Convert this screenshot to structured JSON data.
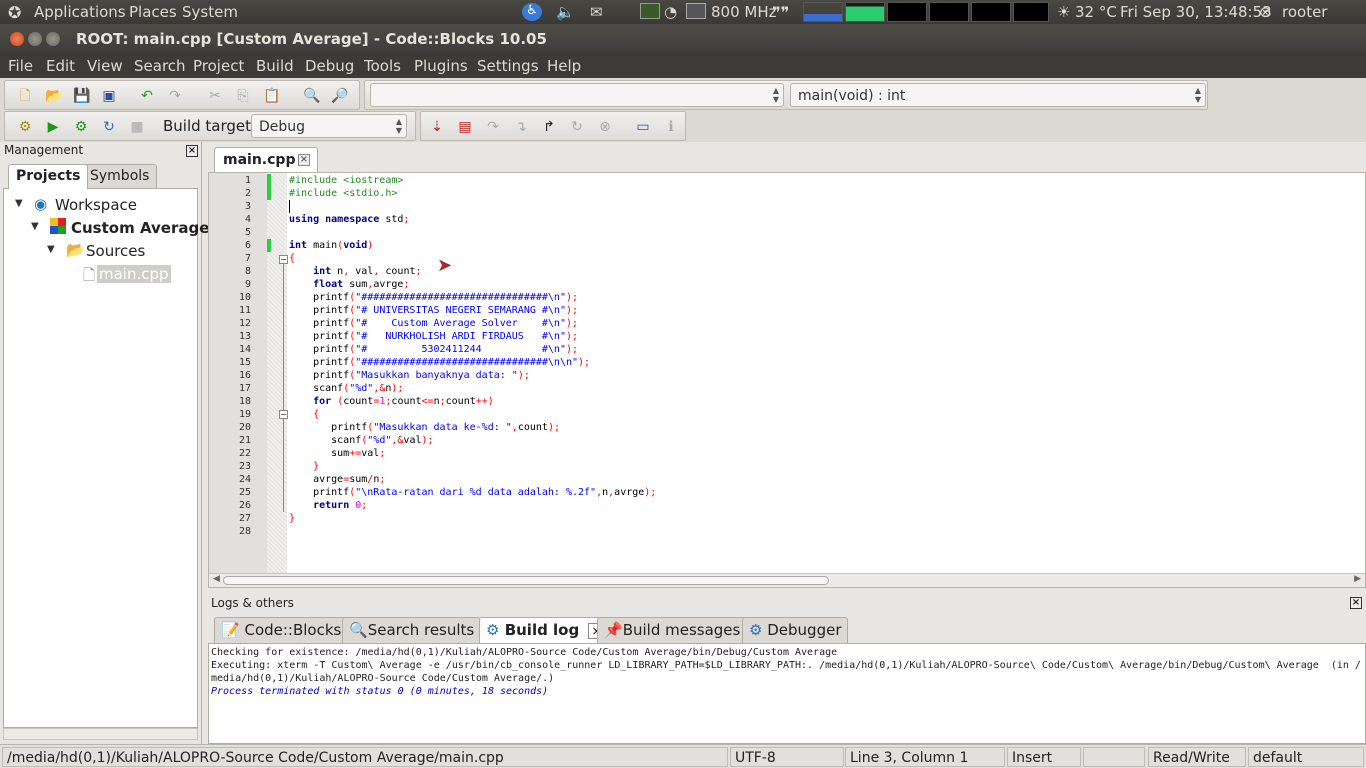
{
  "top_panel": {
    "menus": [
      "Applications",
      "Places",
      "System"
    ],
    "cpu_freq": "800 MHz",
    "weather": "32 °C",
    "clock": "Fri Sep 30, 13:48:53",
    "user": "rooter"
  },
  "window": {
    "title": "ROOT: main.cpp [Custom Average] - Code::Blocks 10.05"
  },
  "menubar": [
    "File",
    "Edit",
    "View",
    "Search",
    "Project",
    "Build",
    "Debug",
    "Tools",
    "Plugins",
    "Settings",
    "Help"
  ],
  "toolbar": {
    "symbol_combo_left": "",
    "symbol_combo_right": "main(void) : int",
    "build_target_label": "Build target:",
    "build_target_value": "Debug"
  },
  "management": {
    "title": "Management",
    "tabs": [
      "Projects",
      "Symbols"
    ],
    "tree": {
      "workspace": "Workspace",
      "project": "Custom Average",
      "folder": "Sources",
      "file": "main.cpp"
    }
  },
  "editor": {
    "tab": "main.cpp",
    "lines": [
      "1",
      "2",
      "3",
      "4",
      "5",
      "6",
      "7",
      "8",
      "9",
      "10",
      "11",
      "12",
      "13",
      "14",
      "15",
      "16",
      "17",
      "18",
      "19",
      "20",
      "21",
      "22",
      "23",
      "24",
      "25",
      "26",
      "27",
      "28"
    ]
  },
  "logs": {
    "title": "Logs & others",
    "tabs": [
      "Code::Blocks",
      "Search results",
      "Build log",
      "Build messages",
      "Debugger"
    ],
    "log_lines": [
      "Checking for existence: /media/hd(0,1)/Kuliah/ALOPRO-Source Code/Custom Average/bin/Debug/Custom Average",
      "Executing: xterm -T Custom\\ Average -e /usr/bin/cb_console_runner LD_LIBRARY_PATH=$LD_LIBRARY_PATH:. /media/hd(0,1)/Kuliah/ALOPRO-Source\\ Code/Custom\\ Average/bin/Debug/Custom\\ Average  (in /",
      "media/hd(0,1)/Kuliah/ALOPRO-Source Code/Custom Average/.)",
      "Process terminated with status 0 (0 minutes, 18 seconds)"
    ]
  },
  "statusbar": {
    "path": "/media/hd(0,1)/Kuliah/ALOPRO-Source Code/Custom Average/main.cpp",
    "encoding": "UTF-8",
    "position": "Line 3, Column 1",
    "mode": "Insert",
    "access": "Read/Write",
    "profile": "default"
  },
  "colors": {
    "panel_bg": "#3c3b37",
    "changed_line_marker": "#2ecc40",
    "preprocessor": "#228b22",
    "keyword": "#00008b",
    "string": "#0000ff",
    "number": "#ff00ff"
  }
}
